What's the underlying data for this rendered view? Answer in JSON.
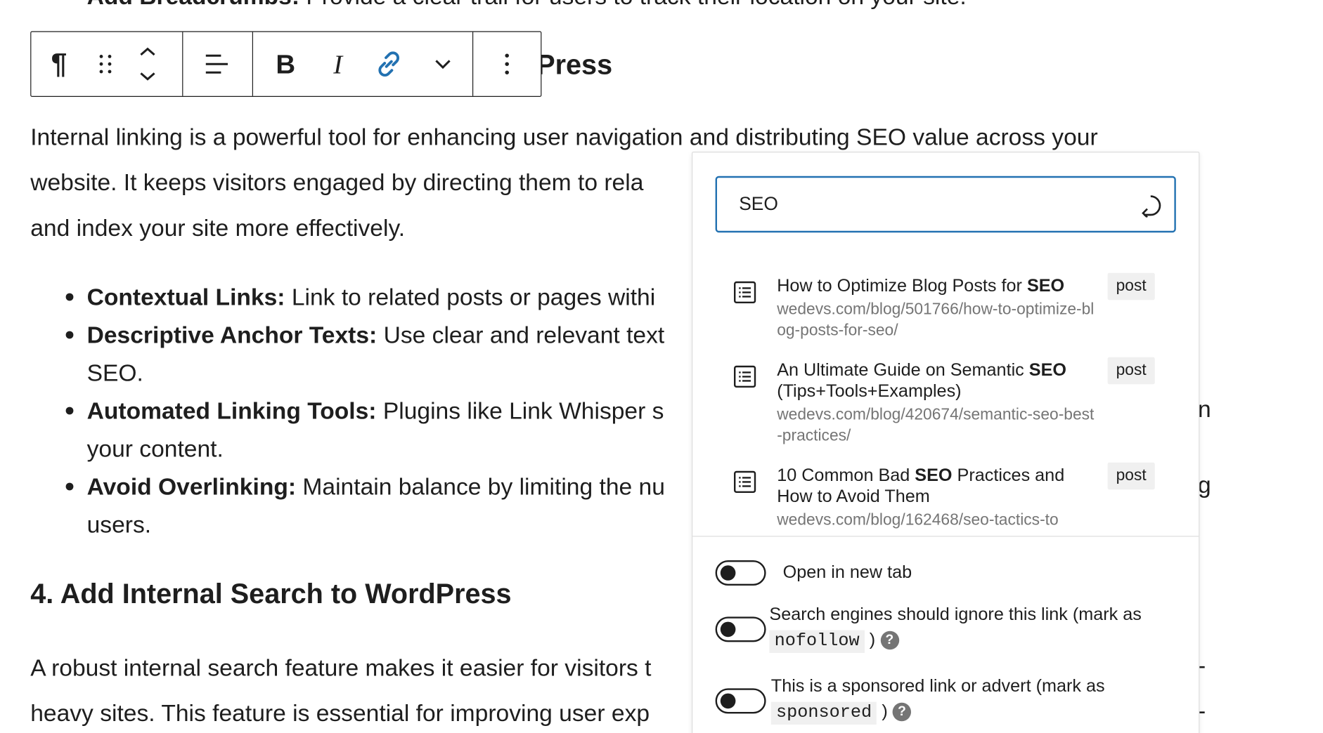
{
  "article": {
    "cut_line_bold": "Add Breadcrumbs:",
    "cut_line_text": " Provide a clear trail for users to track their location on your site.",
    "heading_fragment": "Press",
    "paragraph1": [
      "Internal linking is a powerful tool for enhancing user navigation and distributing SEO value across your",
      "website. It keeps visitors engaged by directing them to rela",
      "and index your site more effectively."
    ],
    "bullets": [
      {
        "bold": "Contextual Links:",
        "text": " Link to related posts or pages withi",
        "line2": ""
      },
      {
        "bold": "Descriptive Anchor Texts:",
        "text": " Use clear and relevant text",
        "line2": "SEO."
      },
      {
        "bold": "Automated Linking Tools:",
        "text": " Plugins like Link Whisper s",
        "line2": "your content."
      },
      {
        "bold": "Avoid Overlinking:",
        "text": " Maintain balance by limiting the nu",
        "line2": "users."
      }
    ],
    "right_stubs": [
      "n",
      "g"
    ],
    "heading4": "4. Add Internal Search to WordPress",
    "paragraph2": [
      "A robust internal search feature makes it easier for visitors t",
      "heavy sites. This feature is essential for improving user exp"
    ],
    "paragraph2_stubs": [
      "-",
      "-"
    ]
  },
  "toolbar": {
    "buttons": [
      "paragraph-icon",
      "drag-handle-icon",
      "move-up-down-icon",
      "align-icon",
      "bold-icon",
      "italic-icon",
      "link-icon",
      "more-rich-text-icon",
      "options-icon"
    ],
    "bold_label": "B",
    "italic_label": "I",
    "paragraph_label": "¶",
    "link_color": "#2271b1"
  },
  "link_popover": {
    "search_value": "SEO",
    "results": [
      {
        "title_pre": "How to Optimize Blog Posts for ",
        "title_bold": "SEO",
        "title_post": "",
        "url": "wedevs.com/blog/501766/how-to-optimize-blog-posts-for-seo/",
        "type": "post"
      },
      {
        "title_pre": "An Ultimate Guide on Semantic ",
        "title_bold": "SEO",
        "title_post": " (Tips+Tools+Examples)",
        "url": "wedevs.com/blog/420674/semantic-seo-best-practices/",
        "type": "post"
      },
      {
        "title_pre": "10 Common Bad ",
        "title_bold": "SEO",
        "title_post": " Practices and How to Avoid Them",
        "url": "wedevs.com/blog/162468/seo-tactics-to",
        "type": "post"
      }
    ],
    "options": {
      "new_tab": "Open in new tab",
      "nofollow_pre": "Search engines should ignore this link (mark as",
      "nofollow_code": "nofollow",
      "nofollow_post": ")",
      "sponsored_pre": "This is a sponsored link or advert (mark as",
      "sponsored_code": "sponsored",
      "sponsored_post": ")",
      "help_glyph": "?"
    }
  }
}
